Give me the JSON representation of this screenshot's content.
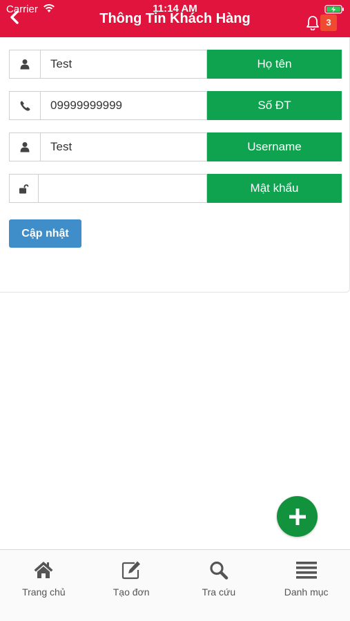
{
  "status_bar": {
    "carrier": "Carrier",
    "time": "11:14 AM"
  },
  "header": {
    "title": "Thông Tin Khách Hàng",
    "notification_count": "3"
  },
  "form": {
    "fields": [
      {
        "icon": "user-icon",
        "value": "Test",
        "label": "Họ tên"
      },
      {
        "icon": "phone-icon",
        "value": "09999999999",
        "label": "Số ĐT"
      },
      {
        "icon": "user-icon",
        "value": "Test",
        "label": "Username"
      },
      {
        "icon": "unlock-icon",
        "value": "",
        "label": "Mật khẩu"
      }
    ],
    "submit_label": "Cập nhật"
  },
  "fab": {
    "icon": "plus-icon"
  },
  "bottom_nav": {
    "items": [
      {
        "icon": "home-icon",
        "label": "Trang chủ"
      },
      {
        "icon": "edit-icon",
        "label": "Tạo đơn"
      },
      {
        "icon": "search-icon",
        "label": "Tra cứu"
      },
      {
        "icon": "menu-icon",
        "label": "Danh mục"
      }
    ]
  },
  "colors": {
    "header_bg": "#e0143c",
    "label_bg": "#0fa24f",
    "button_bg": "#3f8ec9",
    "fab_bg": "#13923d",
    "badge_bg": "#f04a30"
  }
}
